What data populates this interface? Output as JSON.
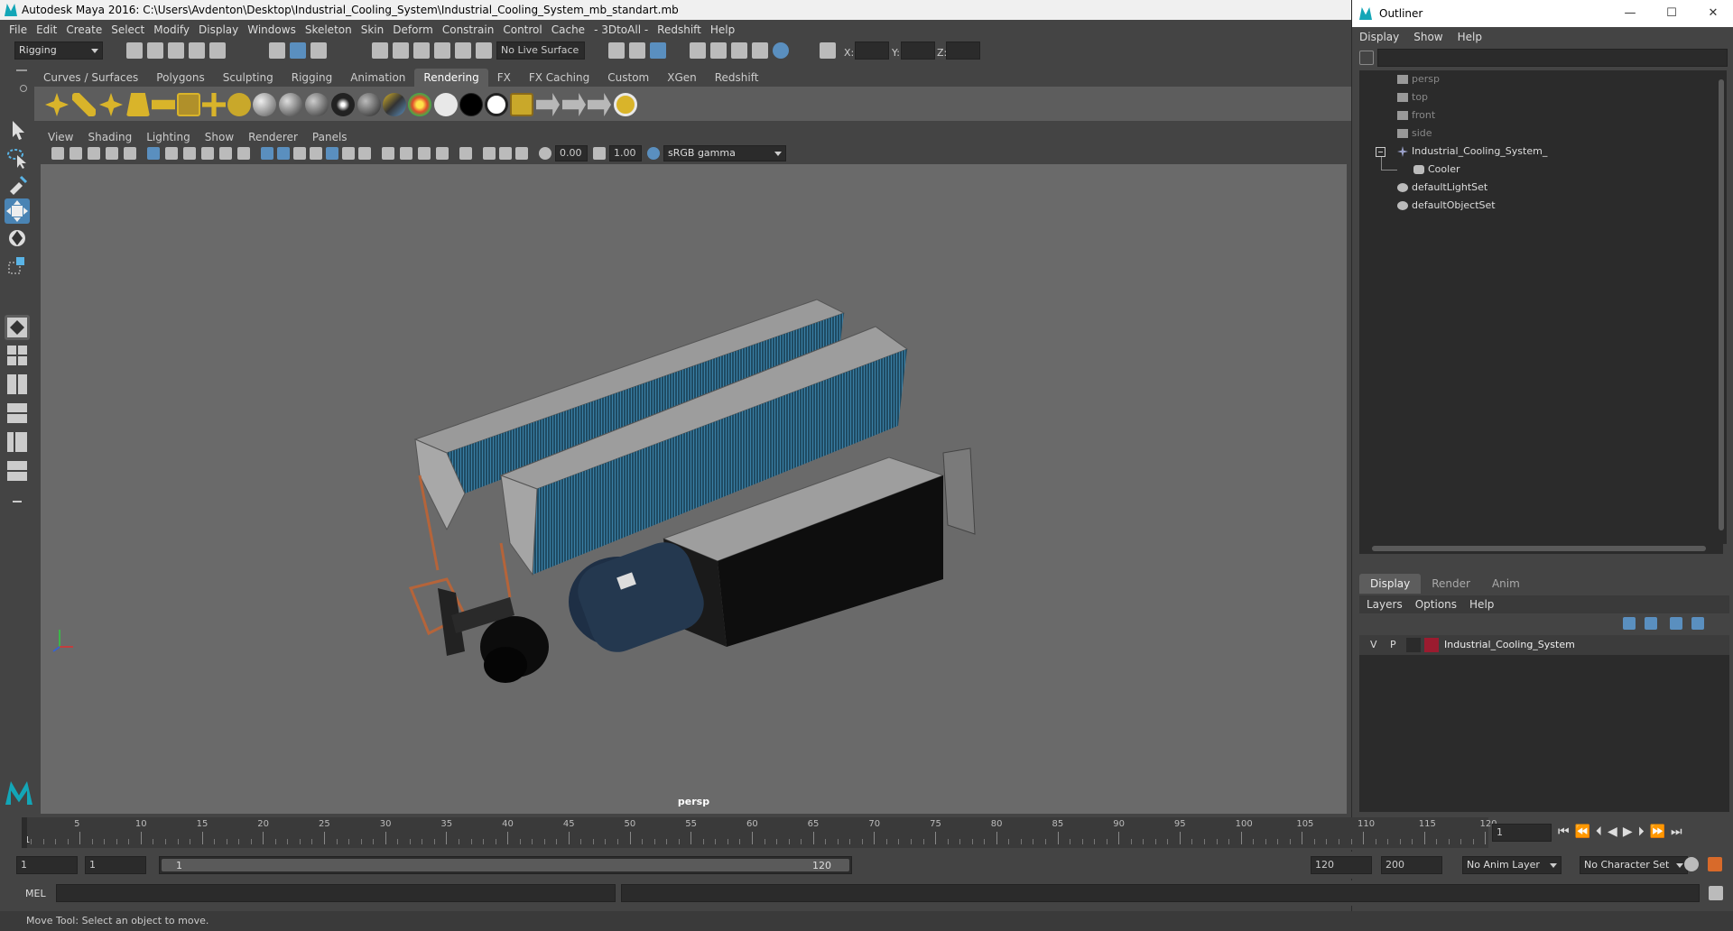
{
  "window": {
    "title": "Autodesk Maya 2016: C:\\Users\\Avdenton\\Desktop\\Industrial_Cooling_System\\Industrial_Cooling_System_mb_standart.mb"
  },
  "menubar": [
    "File",
    "Edit",
    "Create",
    "Select",
    "Modify",
    "Display",
    "Windows",
    "Skeleton",
    "Skin",
    "Deform",
    "Constrain",
    "Control",
    "Cache",
    "- 3DtoAll -",
    "Redshift",
    "Help"
  ],
  "statusline": {
    "mode": "Rigging",
    "live_surface": "No Live Surface",
    "x_label": "X:",
    "y_label": "Y:",
    "z_label": "Z:"
  },
  "shelf_tabs": [
    "Curves / Surfaces",
    "Polygons",
    "Sculpting",
    "Rigging",
    "Animation",
    "Rendering",
    "FX",
    "FX Caching",
    "Custom",
    "XGen",
    "Redshift"
  ],
  "shelf_active": "Rendering",
  "viewport": {
    "menu": [
      "View",
      "Shading",
      "Lighting",
      "Show",
      "Renderer",
      "Panels"
    ],
    "exposure": "0.00",
    "gamma": "1.00",
    "color_space": "sRGB gamma",
    "camera_label": "persp"
  },
  "outliner": {
    "title": "Outliner",
    "menu": [
      "Display",
      "Show",
      "Help"
    ],
    "items": [
      {
        "label": "persp",
        "dim": true
      },
      {
        "label": "top",
        "dim": true
      },
      {
        "label": "front",
        "dim": true
      },
      {
        "label": "side",
        "dim": true
      },
      {
        "label": "Industrial_Cooling_System_",
        "dim": false
      },
      {
        "label": "Cooler",
        "dim": false
      },
      {
        "label": "defaultLightSet",
        "dim": false
      },
      {
        "label": "defaultObjectSet",
        "dim": false
      }
    ]
  },
  "layer_editor": {
    "tabs": [
      "Display",
      "Render",
      "Anim"
    ],
    "active_tab": "Display",
    "menu": [
      "Layers",
      "Options",
      "Help"
    ],
    "layer": {
      "v": "V",
      "p": "P",
      "name": "Industrial_Cooling_System",
      "color": "#9b1b2f"
    }
  },
  "timeline": {
    "ticks": [
      "5",
      "10",
      "15",
      "20",
      "25",
      "30",
      "35",
      "40",
      "45",
      "50",
      "55",
      "60",
      "65",
      "70",
      "75",
      "80",
      "85",
      "90",
      "95",
      "100",
      "105",
      "110",
      "115",
      "120"
    ],
    "start_marker": "1",
    "current_frame": "1"
  },
  "range": {
    "start": "1",
    "playback_start": "1",
    "slider_start": "1",
    "slider_end": "120",
    "playback_end": "120",
    "end": "200",
    "anim_layer": "No Anim Layer",
    "character_set": "No Character Set"
  },
  "command": {
    "label": "MEL"
  },
  "help_line": "Move Tool: Select an object to move."
}
